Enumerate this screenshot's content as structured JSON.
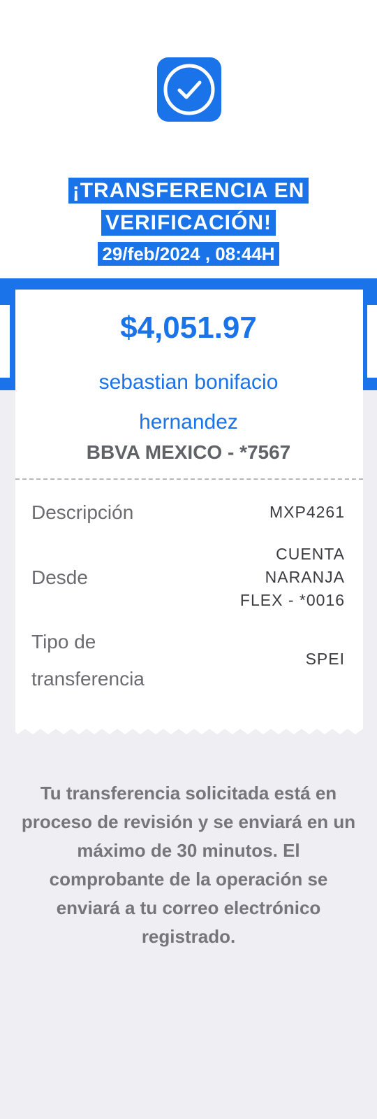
{
  "status": {
    "icon": "check-circle-icon",
    "title_line1": "¡TRANSFERENCIA EN",
    "title_line2": "VERIFICACIÓN!",
    "datetime": "29/feb/2024 , 08:44H"
  },
  "receipt": {
    "amount": "$4,051.97",
    "beneficiary_line1": "sebastian bonifacio",
    "beneficiary_line2": "hernandez",
    "bank": "BBVA MEXICO - *7567",
    "details": {
      "description": {
        "label": "Descripción",
        "value": "MXP4261"
      },
      "from": {
        "label": "Desde",
        "value_line1": "CUENTA",
        "value_line2": "NARANJA",
        "value_line3": "FLEX - *0016"
      },
      "transfer_type": {
        "label_line1": "Tipo de",
        "label_line2": "transferencia",
        "value": "SPEI"
      }
    }
  },
  "notice": "Tu transferencia solicitada está en proceso de revisión y se enviará en un máximo de 30 minutos. El comprobante de la operación se enviará a tu correo electrónico registrado.",
  "colors": {
    "accent": "#1a73e8",
    "background": "#eeeef3",
    "muted_text": "#75757a"
  }
}
